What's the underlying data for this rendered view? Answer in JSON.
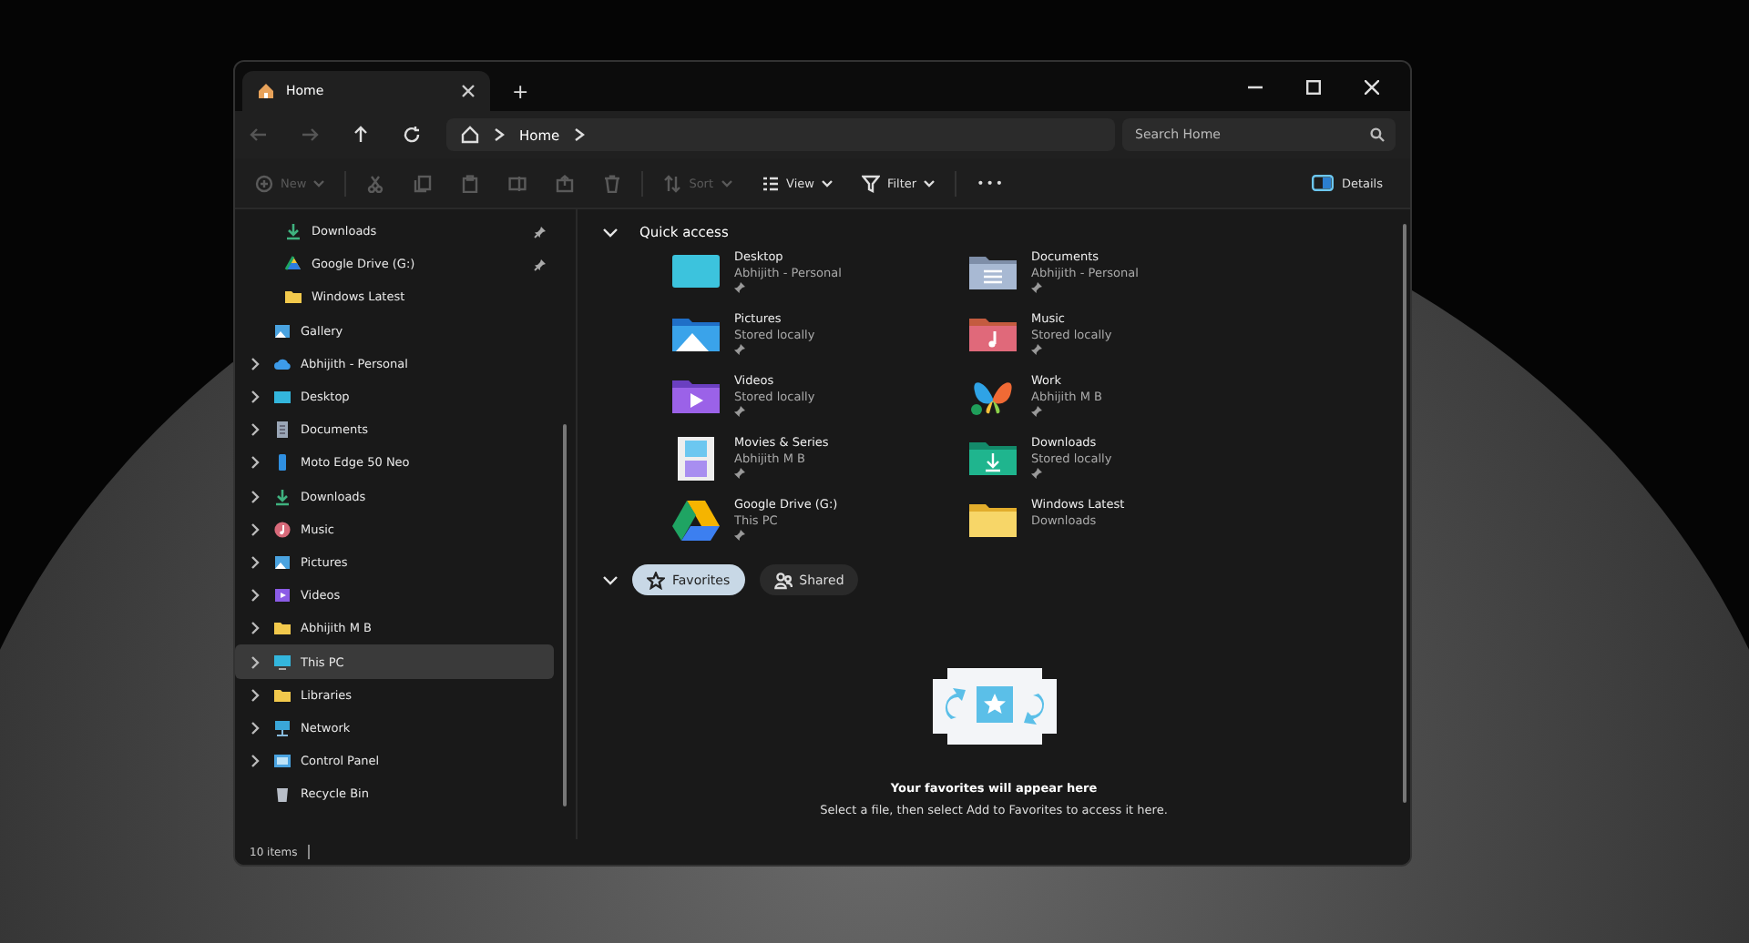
{
  "window": {
    "tab": {
      "title": "Home",
      "selected": true
    },
    "new_tab": "+"
  },
  "address_bar": {
    "path": [
      "Home"
    ]
  },
  "search": {
    "placeholder": "Search Home"
  },
  "toolbar": [
    {
      "kind": "new",
      "label": "New",
      "disabled": true
    },
    {
      "kind": "cut",
      "disabled": true
    },
    {
      "kind": "copy",
      "disabled": true
    },
    {
      "kind": "paste",
      "disabled": true
    },
    {
      "kind": "rename",
      "disabled": true
    },
    {
      "kind": "share",
      "disabled": true
    },
    {
      "kind": "delete",
      "disabled": true
    },
    {
      "kind": "sort",
      "label": "Sort",
      "disabled": true
    },
    {
      "kind": "view",
      "label": "View",
      "disabled": false
    },
    {
      "kind": "filter",
      "label": "Filter",
      "disabled": false
    },
    {
      "kind": "more",
      "label": "•••",
      "disabled": false
    }
  ],
  "details_button": "Details",
  "sidebar": {
    "items": [
      {
        "label": "Downloads",
        "indent": true,
        "expandable": false,
        "pinned": true,
        "selected": false
      },
      {
        "label": "Google Drive (G:)",
        "indent": true,
        "expandable": false,
        "pinned": true,
        "selected": false
      },
      {
        "label": "Windows Latest",
        "indent": true,
        "expandable": false,
        "pinned": false,
        "selected": false
      },
      {
        "label": "Gallery",
        "indent": false,
        "expandable": false,
        "pinned": false,
        "selected": false
      },
      {
        "label": "Abhijith - Personal",
        "indent": false,
        "expandable": true,
        "pinned": false,
        "selected": false
      },
      {
        "label": "Desktop",
        "indent": false,
        "expandable": true,
        "pinned": false,
        "selected": false
      },
      {
        "label": "Documents",
        "indent": false,
        "expandable": true,
        "pinned": false,
        "selected": false
      },
      {
        "label": "Moto Edge 50 Neo",
        "indent": false,
        "expandable": true,
        "pinned": false,
        "selected": false
      },
      {
        "label": "Downloads",
        "indent": false,
        "expandable": true,
        "pinned": false,
        "selected": false
      },
      {
        "label": "Music",
        "indent": false,
        "expandable": true,
        "pinned": false,
        "selected": false
      },
      {
        "label": "Pictures",
        "indent": false,
        "expandable": true,
        "pinned": false,
        "selected": false
      },
      {
        "label": "Videos",
        "indent": false,
        "expandable": true,
        "pinned": false,
        "selected": false
      },
      {
        "label": "Abhijith M B",
        "indent": false,
        "expandable": true,
        "pinned": false,
        "selected": false
      },
      {
        "label": "This PC",
        "indent": false,
        "expandable": true,
        "pinned": false,
        "selected": true
      },
      {
        "label": "Libraries",
        "indent": false,
        "expandable": true,
        "pinned": false,
        "selected": false
      },
      {
        "label": "Network",
        "indent": false,
        "expandable": true,
        "pinned": false,
        "selected": false
      },
      {
        "label": "Control Panel",
        "indent": false,
        "expandable": true,
        "pinned": false,
        "selected": false
      },
      {
        "label": "Recycle Bin",
        "indent": false,
        "expandable": false,
        "pinned": false,
        "selected": false
      }
    ]
  },
  "quick_access": {
    "title": "Quick access",
    "expanded": true,
    "items": [
      {
        "name": "Desktop",
        "location": "Abhijith - Personal",
        "pinned": true
      },
      {
        "name": "Documents",
        "location": "Abhijith - Personal",
        "pinned": true
      },
      {
        "name": "Pictures",
        "location": "Stored locally",
        "pinned": true
      },
      {
        "name": "Music",
        "location": "Stored locally",
        "pinned": true
      },
      {
        "name": "Videos",
        "location": "Stored locally",
        "pinned": true
      },
      {
        "name": "Work",
        "location": "Abhijith M B",
        "pinned": true
      },
      {
        "name": "Movies & Series",
        "location": "Abhijith M B",
        "pinned": true
      },
      {
        "name": "Downloads",
        "location": "Stored locally",
        "pinned": true
      },
      {
        "name": "Google Drive (G:)",
        "location": "This PC",
        "pinned": true
      },
      {
        "name": "Windows Latest",
        "location": "Downloads",
        "pinned": false
      }
    ]
  },
  "favorites_tabs": [
    {
      "label": "Favorites",
      "selected": true
    },
    {
      "label": "Shared",
      "selected": false
    }
  ],
  "empty_state": {
    "title": "Your favorites will appear here",
    "message": "Select a file, then select Add to Favorites to access it here."
  },
  "status_bar": {
    "count": "10 items"
  }
}
